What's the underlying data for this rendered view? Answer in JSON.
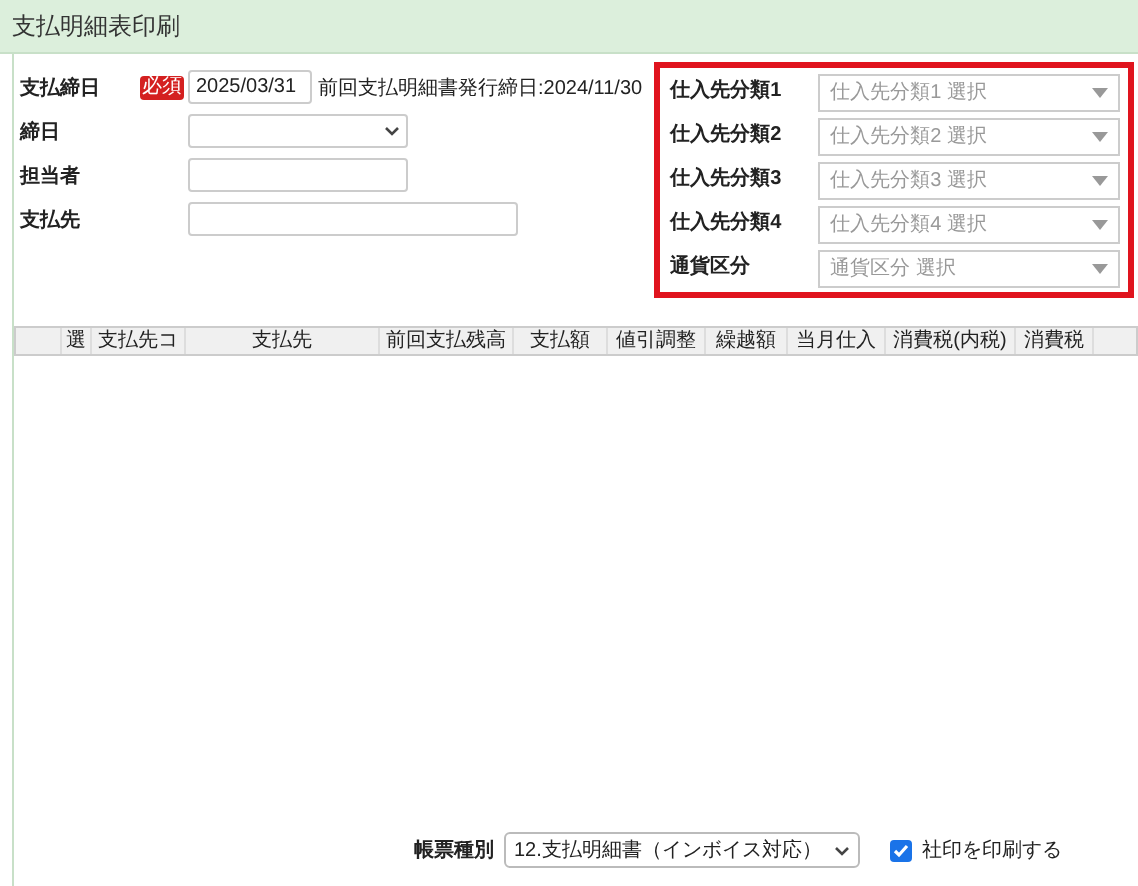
{
  "title": "支払明細表印刷",
  "left_form": {
    "fields": [
      {
        "label": "支払締日",
        "kind": "text",
        "badge": "必須",
        "value": "2025/03/31",
        "note": "前回支払明細書発行締日:2024/11/30"
      },
      {
        "label": "締日",
        "kind": "select"
      },
      {
        "label": "担当者",
        "kind": "text"
      },
      {
        "label": "支払先",
        "kind": "wide"
      }
    ]
  },
  "right_form": {
    "fields": [
      {
        "label": "仕入先分類1",
        "placeholder": "仕入先分類1 選択"
      },
      {
        "label": "仕入先分類2",
        "placeholder": "仕入先分類2 選択"
      },
      {
        "label": "仕入先分類3",
        "placeholder": "仕入先分類3 選択"
      },
      {
        "label": "仕入先分類4",
        "placeholder": "仕入先分類4 選択"
      },
      {
        "label": "通貨区分",
        "placeholder": "通貨区分 選択"
      }
    ]
  },
  "table": {
    "columns": [
      "選",
      "支払先コ",
      "支払先",
      "前回支払残高",
      "支払額",
      "値引調整",
      "繰越額",
      "当月仕入",
      "消費税(内税)",
      "消費税"
    ]
  },
  "footer": {
    "report_type": {
      "label": "帳票種別",
      "value": "12.支払明細書（インボイス対応）"
    },
    "stamp": {
      "label": "社印を印刷する",
      "checked": true
    }
  }
}
